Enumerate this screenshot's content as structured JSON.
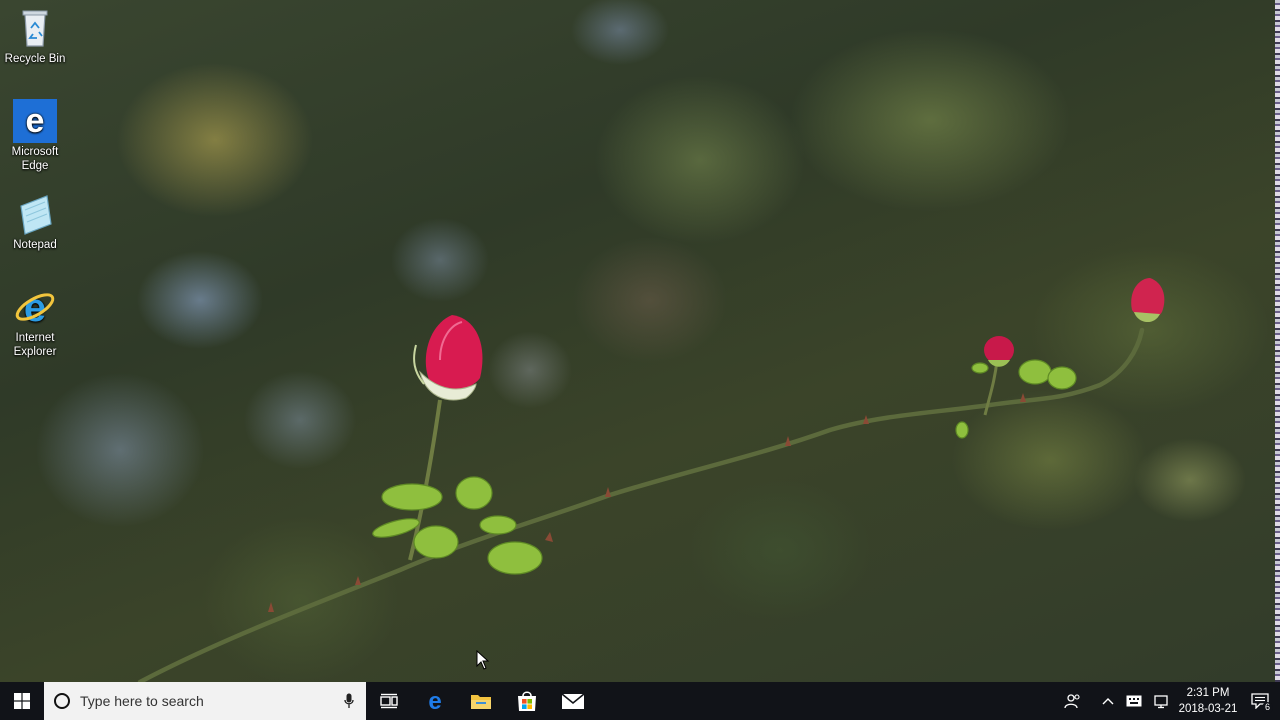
{
  "desktop": {
    "icons": [
      {
        "label": "Recycle Bin",
        "icon": "recycle-bin-icon"
      },
      {
        "label": "Microsoft Edge",
        "icon": "edge-icon"
      },
      {
        "label": "Notepad",
        "icon": "notepad-icon"
      },
      {
        "label": "Internet Explorer",
        "icon": "internet-explorer-icon"
      }
    ]
  },
  "taskbar": {
    "search_placeholder": "Type here to search",
    "pinned_apps": [
      "task-view-icon",
      "edge-icon",
      "file-explorer-icon",
      "store-icon",
      "mail-icon"
    ],
    "tray_icons": [
      "people-icon",
      "chevron-up-icon",
      "keyboard-icon",
      "network-icon"
    ],
    "clock": {
      "time": "2:31 PM",
      "date": "2018-03-21"
    },
    "notifications": {
      "count": "6"
    }
  },
  "colors": {
    "taskbar_bg": "#111318",
    "search_bg": "#f2f2f2",
    "edge_blue": "#1e6fd6",
    "rose_pink": "#d81b50"
  }
}
